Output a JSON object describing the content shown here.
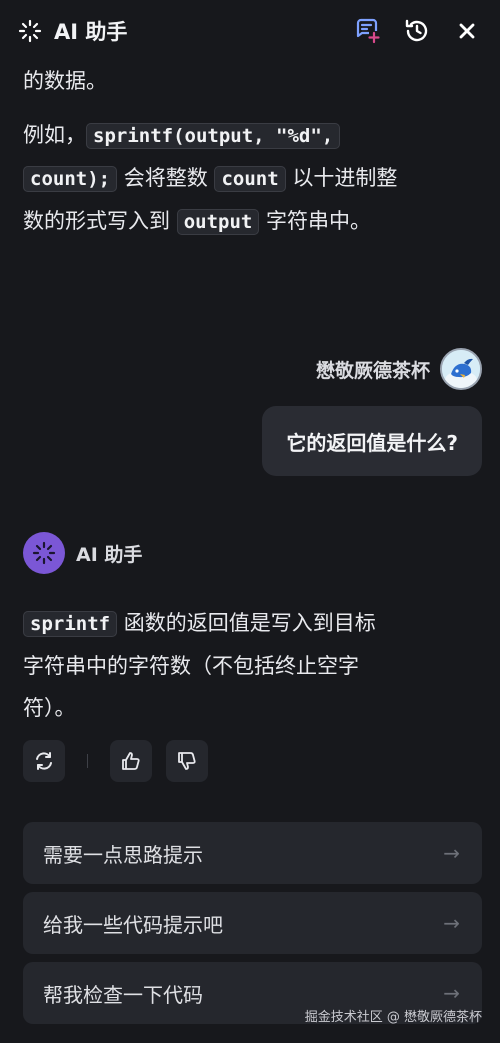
{
  "header": {
    "title": "AI 助手",
    "icons": [
      "sparkle-logo-icon",
      "new-chat-icon",
      "history-icon",
      "close-icon"
    ]
  },
  "assistant_prev": {
    "line1": "的数据。",
    "p2_a": "例如，",
    "p2_code1": "sprintf(output, \"%d\",",
    "p2_code1b": "count);",
    "p2_b": "会将整数",
    "p2_code2": "count",
    "p2_c": "以十进制整",
    "p2_d": "数的形式写入到",
    "p2_code3": "output",
    "p2_e": "字符串中。"
  },
  "user": {
    "name": "懋敬厥德茶杯",
    "message": "它的返回值是什么?"
  },
  "assistant": {
    "name": "AI 助手",
    "code": "sprintf",
    "text1": "函数的返回值是写入到目标",
    "text2": "字符串中的字符数（不包括终止空字",
    "text3": "符）。"
  },
  "actions": [
    "regenerate-icon",
    "thumbs-up-icon",
    "thumbs-down-icon"
  ],
  "suggestions": [
    "需要一点思路提示",
    "给我一些代码提示吧",
    "帮我检查一下代码"
  ],
  "suggestion_arrow": "→",
  "watermark": "掘金技术社区 @ 懋敬厥德茶杯",
  "colors": {
    "background": "#17181c",
    "bubble": "#2a2c33",
    "accent": "#7b57d6",
    "logo": "#7ea1ff"
  }
}
